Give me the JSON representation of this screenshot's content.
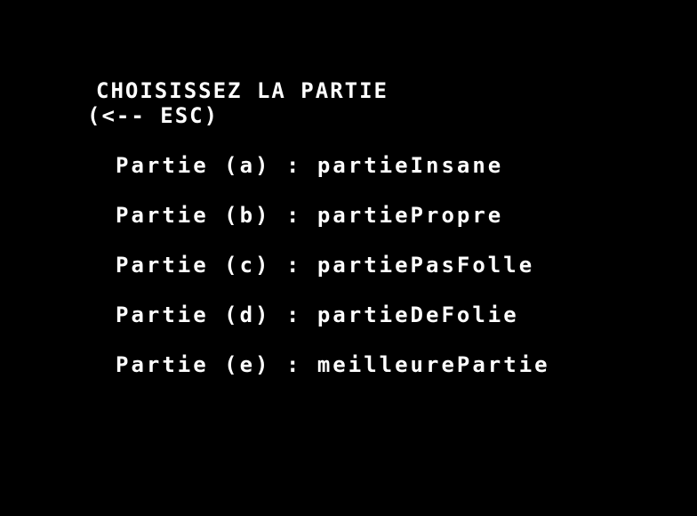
{
  "screen": {
    "title": "CHOISISSEZ LA PARTIE",
    "esc_hint": "(<-- ESC)"
  },
  "menu": {
    "items": [
      {
        "label": "Partie (a)",
        "separator": " : ",
        "name": "partieInsane"
      },
      {
        "label": "Partie (b)",
        "separator": " : ",
        "name": "partiePropre"
      },
      {
        "label": "Partie (c)",
        "separator": " : ",
        "name": "partiePasFolle"
      },
      {
        "label": "Partie (d)",
        "separator": " : ",
        "name": "partieDeFolie"
      },
      {
        "label": "Partie (e)",
        "separator": " : ",
        "name": "meilleurePartie"
      }
    ]
  },
  "colors": {
    "background": "#000000",
    "text": "#ffffff"
  }
}
